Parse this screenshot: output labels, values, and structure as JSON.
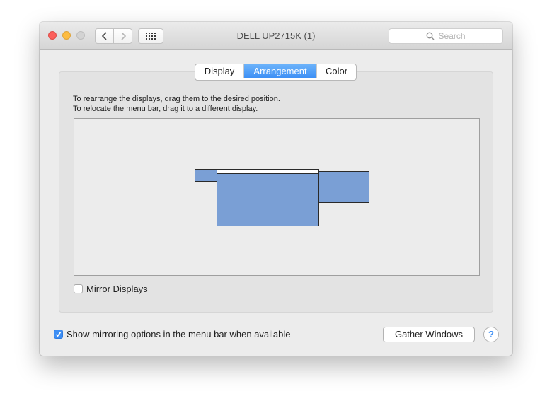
{
  "window": {
    "title": "DELL UP2715K (1)"
  },
  "toolbar": {
    "back_icon": "chevron-left-icon",
    "forward_icon": "chevron-right-icon",
    "show_all_icon": "grid-icon",
    "search_placeholder": "Search"
  },
  "tabs": [
    {
      "label": "Display",
      "selected": false
    },
    {
      "label": "Arrangement",
      "selected": true
    },
    {
      "label": "Color",
      "selected": false
    }
  ],
  "instructions": {
    "line1": "To rearrange the displays, drag them to the desired position.",
    "line2": "To relocate the menu bar, drag it to a different display."
  },
  "arrangement": {
    "displays": [
      {
        "name": "small-display",
        "has_menu_bar": false
      },
      {
        "name": "main-display",
        "has_menu_bar": true
      },
      {
        "name": "right-display",
        "has_menu_bar": false
      }
    ]
  },
  "options": {
    "mirror_displays": {
      "label": "Mirror Displays",
      "checked": false
    },
    "show_mirroring": {
      "label": "Show mirroring options in the menu bar when available",
      "checked": true
    }
  },
  "buttons": {
    "gather_windows": "Gather Windows",
    "help": "?"
  },
  "colors": {
    "accent": "#3d8ef4",
    "display_fill": "#7a9fd5",
    "close": "#fc605c",
    "minimize": "#fdbc40",
    "zoom_disabled": "#d3d3d3"
  }
}
